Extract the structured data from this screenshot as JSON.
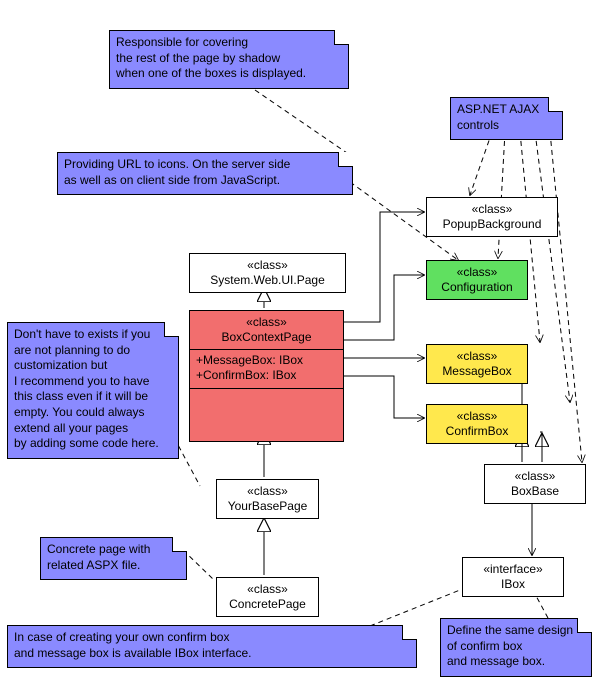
{
  "notes": {
    "shadow": "Responsible for covering\nthe rest of the page by shadow\nwhen one of the boxes is displayed.",
    "ajax": "ASP.NET AJAX\ncontrols",
    "icons": "Providing URL to icons. On the server side\nas well as on client side from JavaScript.",
    "custom": "Don't have to exists if you\nare not planning to do\ncustomization but\nI recommend you to have\nthis class even if it will be\nempty. You could always\nextend all your pages\nby adding some code here.",
    "aspx": "Concrete page with\nrelated ASPX file.",
    "ibox": "In case of creating your own confirm box\nand message box is available IBox interface.",
    "design": "Define the same design\nof confirm box\nand message box."
  },
  "stereo": {
    "cls": "«class»",
    "iface": "«interface»"
  },
  "classes": {
    "page": "System.Web.UI.Page",
    "context": "BoxContextPage",
    "context_attrs": "+MessageBox: IBox\n+ConfirmBox: IBox",
    "yourbase": "YourBasePage",
    "concrete": "ConcretePage",
    "popup": "PopupBackground",
    "config": "Configuration",
    "msg": "MessageBox",
    "confirm": "ConfirmBox",
    "boxbase": "BoxBase",
    "ibox": "IBox"
  }
}
